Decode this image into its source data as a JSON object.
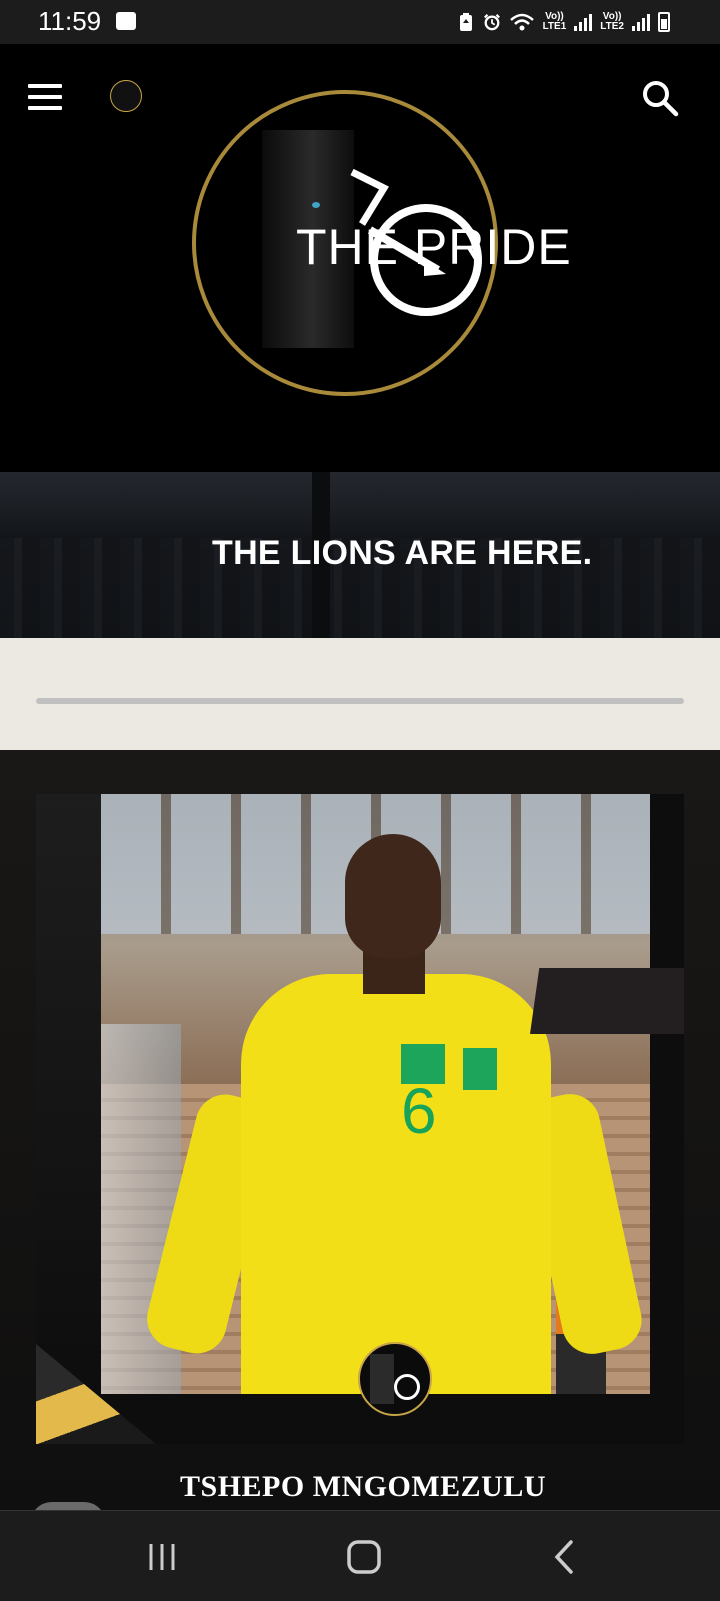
{
  "status_bar": {
    "time": "11:59",
    "lte1": "Vo))\nLTE1",
    "lte2": "Vo))\nLTE2",
    "icons": [
      "image-icon",
      "battery-saver-icon",
      "alarm-icon",
      "wifi-icon",
      "signal-icon",
      "signal-icon",
      "battery-icon"
    ]
  },
  "header": {
    "brand_text": "THE PRIDE",
    "menu_icon": "hamburger-menu-icon",
    "search_icon": "search-icon",
    "accent_color": "#a88a3a"
  },
  "banner": {
    "title": "THE LIONS ARE HERE."
  },
  "progress": {
    "value": 0
  },
  "feature": {
    "player_name": "TSHEPO MNGOMEZULU",
    "jersey_number": "6"
  },
  "nav": {
    "recent_icon": "recent-apps-icon",
    "home_icon": "home-icon",
    "back_icon": "back-icon"
  }
}
